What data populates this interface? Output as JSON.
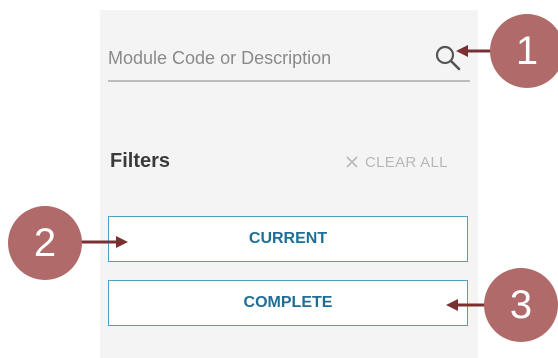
{
  "search": {
    "placeholder": "Module Code or Description",
    "icon": "search-icon"
  },
  "filters": {
    "title": "Filters",
    "clear_all_label": "CLEAR ALL",
    "clear_icon": "close-icon",
    "buttons": [
      {
        "label": "CURRENT"
      },
      {
        "label": "COMPLETE"
      }
    ]
  },
  "callouts": [
    {
      "number": "1"
    },
    {
      "number": "2"
    },
    {
      "number": "3"
    }
  ],
  "colors": {
    "panel_bg": "#f4f4f4",
    "accent_border": "#4f9fc0",
    "button_text": "#1f6f95",
    "callout_fill": "#b06a6a",
    "callout_arrow": "#7a3030"
  }
}
